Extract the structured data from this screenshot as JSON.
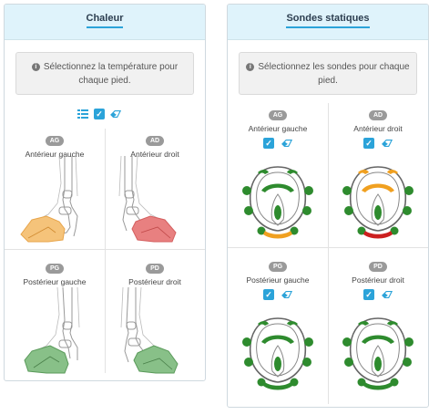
{
  "heat_panel": {
    "title": "Chaleur",
    "info": "Sélectionnez la température pour chaque pied.",
    "cells": [
      {
        "code": "AG",
        "label": "Antérieur gauche",
        "fill": "#f5c37a",
        "stroke": "#e8a54b"
      },
      {
        "code": "AD",
        "label": "Antérieur droit",
        "fill": "#e88080",
        "stroke": "#d45f5f"
      },
      {
        "code": "PG",
        "label": "Postérieur gauche",
        "fill": "#88c088",
        "stroke": "#5a9a5a"
      },
      {
        "code": "PD",
        "label": "Postérieur droit",
        "fill": "#88c088",
        "stroke": "#5a9a5a"
      }
    ]
  },
  "sensors_panel": {
    "title": "Sondes statiques",
    "info": "Sélectionnez les sondes pour chaque pied.",
    "cells": [
      {
        "code": "AG",
        "label": "Antérieur gauche",
        "bulbs": "#2e8b2e",
        "toe": "#f0a020",
        "top": "#2e8b2e"
      },
      {
        "code": "AD",
        "label": "Antérieur droit",
        "bulbs": "#2e8b2e",
        "toe": "#cc1f1f",
        "top": "#f0a020"
      },
      {
        "code": "PG",
        "label": "Postérieur gauche",
        "bulbs": "#2e8b2e",
        "toe": "#2e8b2e",
        "top": "#2e8b2e"
      },
      {
        "code": "PD",
        "label": "Postérieur droit",
        "bulbs": "#2e8b2e",
        "toe": "#2e8b2e",
        "top": "#2e8b2e"
      }
    ]
  },
  "icons": {
    "info": "info-icon",
    "list": "list-icon",
    "check": "checkbox-icon",
    "eraser": "eraser-icon"
  },
  "accent": "#2ba3d9"
}
